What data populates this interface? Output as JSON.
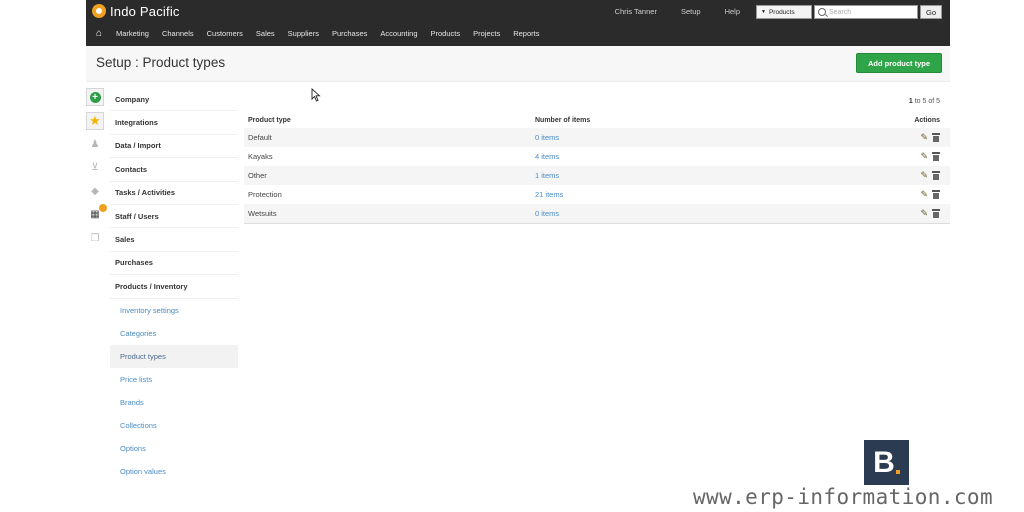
{
  "app": {
    "brand": "Indo Pacific",
    "user_name": "Chris Tanner",
    "setup_link": "Setup",
    "help_link": "Help",
    "search": {
      "scope": "Products",
      "placeholder": "Search",
      "go_label": "Go"
    }
  },
  "mainnav": [
    "Marketing",
    "Channels",
    "Customers",
    "Sales",
    "Suppliers",
    "Purchases",
    "Accounting",
    "Products",
    "Projects",
    "Reports"
  ],
  "page": {
    "title": "Setup : Product types",
    "add_button": "Add product type"
  },
  "rail_icons": [
    "plus-circle-icon",
    "star-icon",
    "users-icon",
    "cart-icon",
    "tag-icon",
    "chart-icon",
    "documents-icon"
  ],
  "menu": {
    "sections": [
      "Company",
      "Integrations",
      "Data / Import",
      "Contacts",
      "Tasks / Activities",
      "Staff / Users",
      "Sales",
      "Purchases",
      "Products / Inventory"
    ],
    "sub_items": [
      "Inventory settings",
      "Categories",
      "Product types",
      "Price lists",
      "Brands",
      "Collections",
      "Options",
      "Option values"
    ],
    "active_sub": "Product types"
  },
  "table": {
    "pager": {
      "start": "1",
      "middle": " to 5 of 5"
    },
    "headers": {
      "type": "Product type",
      "count": "Number of items",
      "actions": "Actions"
    },
    "rows": [
      {
        "type": "Default",
        "count": "0 items"
      },
      {
        "type": "Kayaks",
        "count": "4 items"
      },
      {
        "type": "Other",
        "count": "1 items"
      },
      {
        "type": "Protection",
        "count": "21 items"
      },
      {
        "type": "Wetsuits",
        "count": "0 items"
      }
    ]
  },
  "watermark": {
    "logo_letter": "B",
    "site": "www.erp-information.com"
  },
  "colors": {
    "topbar": "#2b2b2b",
    "accent_green": "#2fa449",
    "link_blue": "#4a8cc6",
    "brand_orange": "#f0a020"
  }
}
